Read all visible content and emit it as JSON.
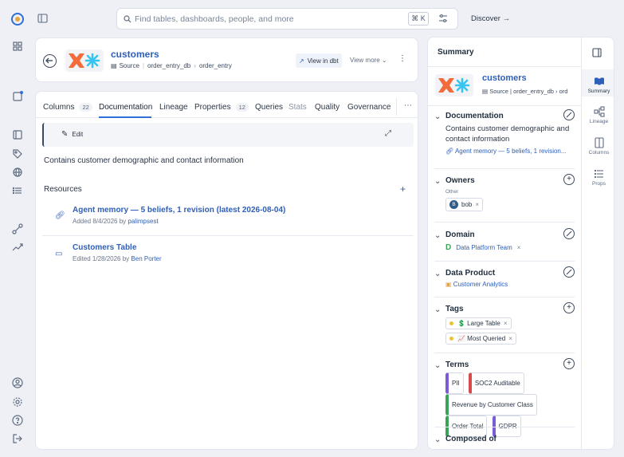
{
  "search": {
    "placeholder": "Find tables, dashboards, people, and more",
    "shortcut": "⌘ K"
  },
  "topnav": {
    "discover": "Discover"
  },
  "asset": {
    "name": "customers",
    "source_label": "Source",
    "database": "order_entry_db",
    "schema": "order_entry",
    "view_in_dbt": "View in dbt",
    "view_more": "View more"
  },
  "tabs": [
    {
      "label": "Columns",
      "count": "22"
    },
    {
      "label": "Documentation"
    },
    {
      "label": "Lineage"
    },
    {
      "label": "Properties",
      "count": "12"
    },
    {
      "label": "Queries"
    },
    {
      "label": "Stats"
    },
    {
      "label": "Quality"
    },
    {
      "label": "Governance"
    }
  ],
  "doc": {
    "edit_label": "Edit",
    "description": "Contains customer demographic and contact information",
    "resources_label": "Resources",
    "resources": [
      {
        "title": "Agent memory — 5 beliefs, 1 revision (latest 2026-08-04)",
        "meta": "Added 8/4/2026 by",
        "author": "palimpsest"
      },
      {
        "title": "Customers Table",
        "meta": "Edited 1/28/2026 by",
        "author": "Ben Porter"
      }
    ]
  },
  "summary": {
    "title": "Summary",
    "name": "customers",
    "source_label": "Source",
    "database": "order_entry_db",
    "schema_partial": "ord",
    "documentation": {
      "label": "Documentation",
      "text": "Contains customer demographic and contact information",
      "link": "Agent memory — 5 beliefs, 1 revision..."
    },
    "owners": {
      "label": "Owners",
      "sublabel": "Other",
      "owner": "bob",
      "owner_initial": "B"
    },
    "domain": {
      "label": "Domain",
      "value": "Data Platform Team",
      "initial": "D"
    },
    "data_product": {
      "label": "Data Product",
      "value": "Customer Analytics"
    },
    "tags": {
      "label": "Tags",
      "items": [
        "💲 Large Table",
        "📈 Most Queried"
      ]
    },
    "terms": {
      "label": "Terms",
      "items": [
        "PII",
        "SOC2 Auditable",
        "Revenue by Customer Class",
        "Order Total",
        "GDPR"
      ]
    },
    "composed_of": {
      "label": "Composed of"
    }
  },
  "right_tabs": [
    "Summary",
    "Lineage",
    "Columns",
    "Props"
  ],
  "colors": {
    "accent": "#2f6fd6",
    "link": "#2f5fb8",
    "domain_green": "#3aa357"
  }
}
